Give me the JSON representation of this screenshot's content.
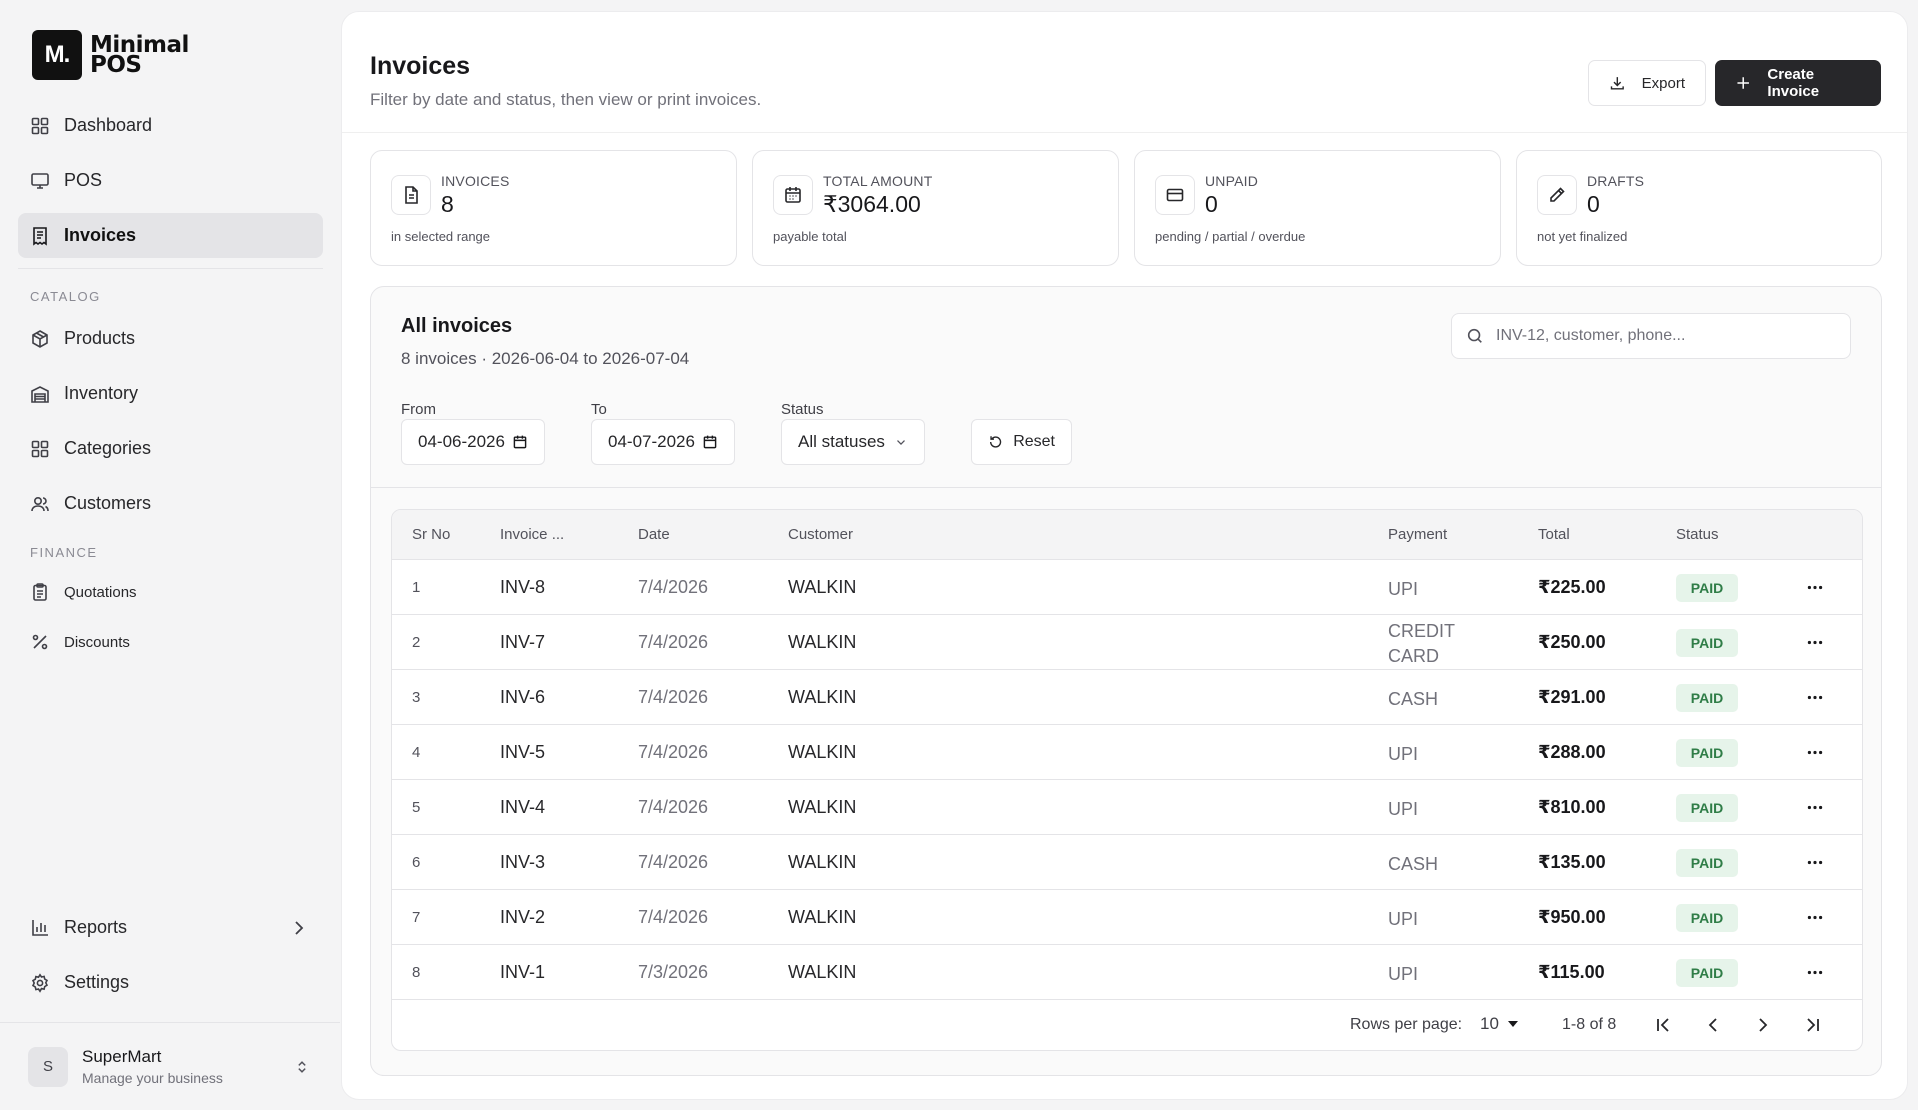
{
  "brand": {
    "mark": "M.",
    "line1": "Minimal",
    "line2": "POS"
  },
  "nav": {
    "items": [
      {
        "label": "Dashboard",
        "icon": "dashboard-icon"
      },
      {
        "label": "POS",
        "icon": "monitor-icon"
      },
      {
        "label": "Invoices",
        "icon": "receipt-icon",
        "active": true
      }
    ],
    "catalog_title": "CATALOG",
    "catalog": [
      {
        "label": "Products",
        "icon": "package-icon"
      },
      {
        "label": "Inventory",
        "icon": "warehouse-icon"
      },
      {
        "label": "Categories",
        "icon": "grid-icon"
      },
      {
        "label": "Customers",
        "icon": "users-icon"
      }
    ],
    "finance_title": "FINANCE",
    "finance": [
      {
        "label": "Quotations",
        "icon": "clipboard-icon"
      },
      {
        "label": "Discounts",
        "icon": "percent-icon"
      }
    ],
    "reports": "Reports",
    "settings": "Settings"
  },
  "user": {
    "initial": "S",
    "name": "SuperMart",
    "subtitle": "Manage your business"
  },
  "header": {
    "title": "Invoices",
    "subtitle": "Filter by date and status, then view or print invoices.",
    "export_label": "Export",
    "create_label": "Create Invoice"
  },
  "stats": [
    {
      "label": "INVOICES",
      "value": "8",
      "note": "in selected range",
      "icon": "file-icon"
    },
    {
      "label": "TOTAL AMOUNT",
      "value": "₹3064.00",
      "note": "payable total",
      "icon": "calendar-icon"
    },
    {
      "label": "UNPAID",
      "value": "0",
      "note": "pending / partial / overdue",
      "icon": "card-icon"
    },
    {
      "label": "DRAFTS",
      "value": "0",
      "note": "not yet finalized",
      "icon": "pencil-icon"
    }
  ],
  "list": {
    "title": "All invoices",
    "subtitle": "8 invoices · 2026-06-04 to 2026-07-04",
    "search_placeholder": "INV-12, customer, phone...",
    "filters": {
      "from_label": "From",
      "from_value": "04-06-2026",
      "to_label": "To",
      "to_value": "04-07-2026",
      "status_label": "Status",
      "status_value": "All statuses",
      "reset_label": "Reset"
    }
  },
  "table": {
    "columns": [
      "Sr No",
      "Invoice ...",
      "Date",
      "Customer",
      "Payment",
      "Total",
      "Status"
    ],
    "rows": [
      {
        "sr": "1",
        "invoice": "INV-8",
        "date": "7/4/2026",
        "customer": "WALKIN",
        "payment": "UPI",
        "total": "₹225.00",
        "status": "PAID"
      },
      {
        "sr": "2",
        "invoice": "INV-7",
        "date": "7/4/2026",
        "customer": "WALKIN",
        "payment": "CREDIT CARD",
        "total": "₹250.00",
        "status": "PAID"
      },
      {
        "sr": "3",
        "invoice": "INV-6",
        "date": "7/4/2026",
        "customer": "WALKIN",
        "payment": "CASH",
        "total": "₹291.00",
        "status": "PAID"
      },
      {
        "sr": "4",
        "invoice": "INV-5",
        "date": "7/4/2026",
        "customer": "WALKIN",
        "payment": "UPI",
        "total": "₹288.00",
        "status": "PAID"
      },
      {
        "sr": "5",
        "invoice": "INV-4",
        "date": "7/4/2026",
        "customer": "WALKIN",
        "payment": "UPI",
        "total": "₹810.00",
        "status": "PAID"
      },
      {
        "sr": "6",
        "invoice": "INV-3",
        "date": "7/4/2026",
        "customer": "WALKIN",
        "payment": "CASH",
        "total": "₹135.00",
        "status": "PAID"
      },
      {
        "sr": "7",
        "invoice": "INV-2",
        "date": "7/4/2026",
        "customer": "WALKIN",
        "payment": "UPI",
        "total": "₹950.00",
        "status": "PAID"
      },
      {
        "sr": "8",
        "invoice": "INV-1",
        "date": "7/3/2026",
        "customer": "WALKIN",
        "payment": "UPI",
        "total": "₹115.00",
        "status": "PAID"
      }
    ],
    "rows_per_page_label": "Rows per page:",
    "rows_per_page": "10",
    "range": "1-8 of 8"
  }
}
